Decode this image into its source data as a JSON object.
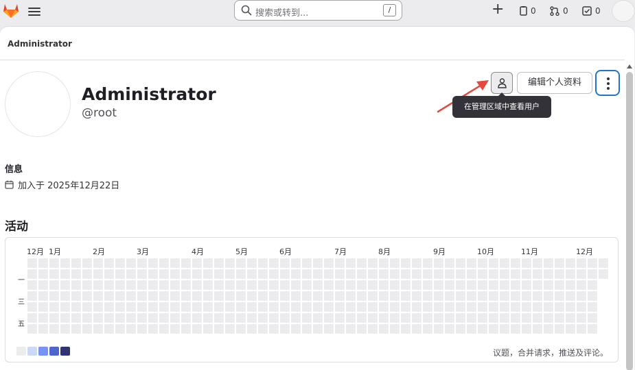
{
  "topbar": {
    "search_placeholder": "搜索或转到...",
    "search_shortcut": "/",
    "issues_count": "0",
    "merge_requests_count": "0",
    "todos_count": "0"
  },
  "breadcrumb": "Administrator",
  "profile": {
    "name": "Administrator",
    "username": "@root",
    "edit_button": "编辑个人资料",
    "view_admin_tooltip": "在管理区域中查看用户"
  },
  "info": {
    "title": "信息",
    "joined": "加入于 2025年12月22日"
  },
  "activity": {
    "title": "活动",
    "months": [
      "12月",
      "1月",
      "2月",
      "3月",
      "4月",
      "5月",
      "6月",
      "7月",
      "8月",
      "9月",
      "10月",
      "11月",
      "12月"
    ],
    "day_labels": [
      "一",
      "三",
      "五"
    ],
    "legend_text": "议题，合并请求，推送及评论。",
    "legend_colors": [
      "#ececef",
      "#cbd8f8",
      "#7992f5",
      "#4e65cd",
      "#303470"
    ]
  },
  "colors": {
    "accent": "#1f75cb",
    "tooltip_bg": "#333238",
    "arrow": "#e5483e",
    "logo": "#e24329"
  }
}
